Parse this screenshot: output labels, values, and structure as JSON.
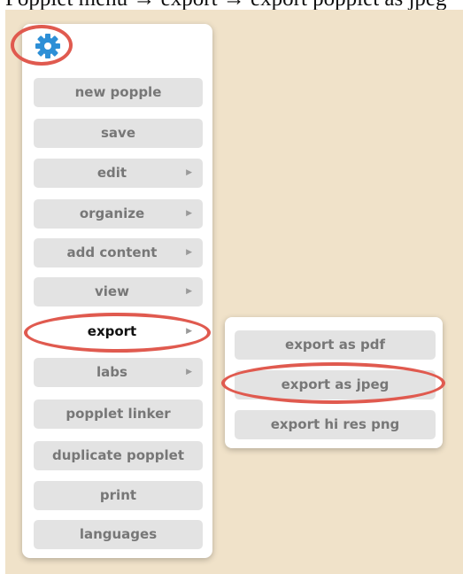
{
  "top_text": "Popplet menu → export → export popplet as jpeg",
  "menu": {
    "settings_icon": "gear-icon",
    "items": [
      {
        "label": "new popple",
        "has_submenu": false
      },
      {
        "label": "save",
        "has_submenu": false
      },
      {
        "label": "edit",
        "has_submenu": true
      },
      {
        "label": "organize",
        "has_submenu": true
      },
      {
        "label": "add content",
        "has_submenu": true
      },
      {
        "label": "view",
        "has_submenu": true
      },
      {
        "label": "export",
        "has_submenu": true,
        "active": true
      },
      {
        "label": "labs",
        "has_submenu": true
      },
      {
        "label": "popplet linker",
        "has_submenu": false
      },
      {
        "label": "duplicate popplet",
        "has_submenu": false
      },
      {
        "label": "print",
        "has_submenu": false
      },
      {
        "label": "languages",
        "has_submenu": false
      }
    ],
    "submenu_arrow": "▶"
  },
  "export_submenu": {
    "items": [
      {
        "label": "export as pdf"
      },
      {
        "label": "export as jpeg",
        "highlighted": true
      },
      {
        "label": "export hi res png"
      }
    ]
  },
  "colors": {
    "canvas_background": "#f0e2c9",
    "highlight_ring": "#e05a4f",
    "gear_icon": "#2d8fd6",
    "menu_item_background": "#e3e3e3"
  }
}
